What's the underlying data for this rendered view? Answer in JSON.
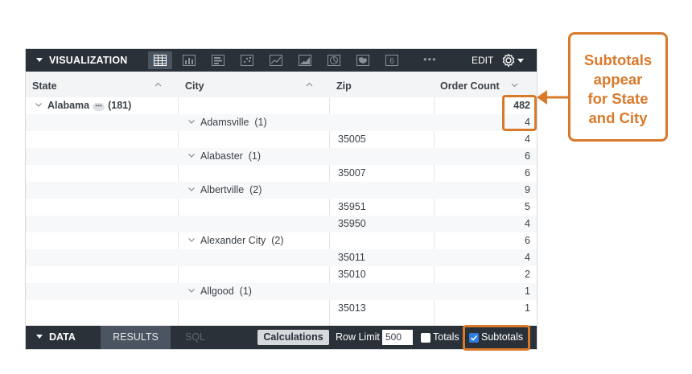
{
  "viz_bar": {
    "title": "VISUALIZATION",
    "more": "•••",
    "edit_label": "EDIT",
    "tab_6_label": "6"
  },
  "table": {
    "headers": {
      "state": "State",
      "city": "City",
      "zip": "Zip",
      "order_count": "Order Count"
    },
    "rows": [
      {
        "state": "Alabama",
        "state_badge": "•••",
        "state_count": "(181)",
        "city": "",
        "zip": "",
        "count": "482"
      },
      {
        "state": "",
        "city": "Adamsville",
        "city_count": "(1)",
        "zip": "",
        "count": "4"
      },
      {
        "state": "",
        "city": "",
        "zip": "35005",
        "count": "4"
      },
      {
        "state": "",
        "city": "Alabaster",
        "city_count": "(1)",
        "zip": "",
        "count": "6"
      },
      {
        "state": "",
        "city": "",
        "zip": "35007",
        "count": "6"
      },
      {
        "state": "",
        "city": "Albertville",
        "city_count": "(2)",
        "zip": "",
        "count": "9"
      },
      {
        "state": "",
        "city": "",
        "zip": "35951",
        "count": "5"
      },
      {
        "state": "",
        "city": "",
        "zip": "35950",
        "count": "4"
      },
      {
        "state": "",
        "city": "Alexander City",
        "city_count": "(2)",
        "zip": "",
        "count": "6"
      },
      {
        "state": "",
        "city": "",
        "zip": "35011",
        "count": "4"
      },
      {
        "state": "",
        "city": "",
        "zip": "35010",
        "count": "2"
      },
      {
        "state": "",
        "city": "Allgood",
        "city_count": "(1)",
        "zip": "",
        "count": "1"
      },
      {
        "state": "",
        "city": "",
        "zip": "35013",
        "count": "1"
      }
    ]
  },
  "data_bar": {
    "title": "DATA",
    "results_tab": "RESULTS",
    "sql_tab": "SQL",
    "calculations_button": "Calculations",
    "row_limit_label": "Row Limit",
    "row_limit_value": "500",
    "totals_label": "Totals",
    "totals_checked": false,
    "subtotals_label": "Subtotals",
    "subtotals_checked": true
  },
  "callout": {
    "line1": "Subtotals",
    "line2": "appear",
    "line3": "for State",
    "line4": "and City"
  },
  "colors": {
    "toolbar_bg": "#2b3139",
    "accent_orange": "#d97a2b",
    "checkbox_blue": "#2f7de1"
  }
}
